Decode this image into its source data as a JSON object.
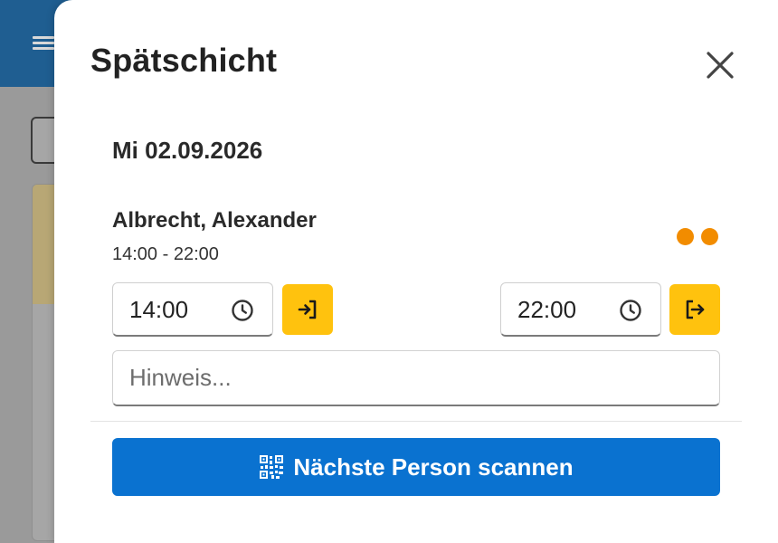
{
  "colors": {
    "header": "#1f5e91",
    "accent_yellow": "#ffc20e",
    "status_orange": "#f28c00",
    "primary_blue": "#0a72d0"
  },
  "modal": {
    "title": "Spätschicht",
    "close_icon": "close-icon",
    "date": "Mi 02.09.2026",
    "person": {
      "name": "Albrecht, Alexander",
      "shift_time": "14:00 - 22:00",
      "status_dots": 2
    },
    "check_in": {
      "time_value": "14:00",
      "clock_icon": "clock-icon",
      "button_icon": "sign-in-icon"
    },
    "check_out": {
      "time_value": "22:00",
      "clock_icon": "clock-icon",
      "button_icon": "sign-out-icon"
    },
    "note": {
      "placeholder": "Hinweis...",
      "value": ""
    },
    "scan_button": {
      "label": "Nächste Person scannen",
      "icon": "qr-code-icon"
    }
  }
}
